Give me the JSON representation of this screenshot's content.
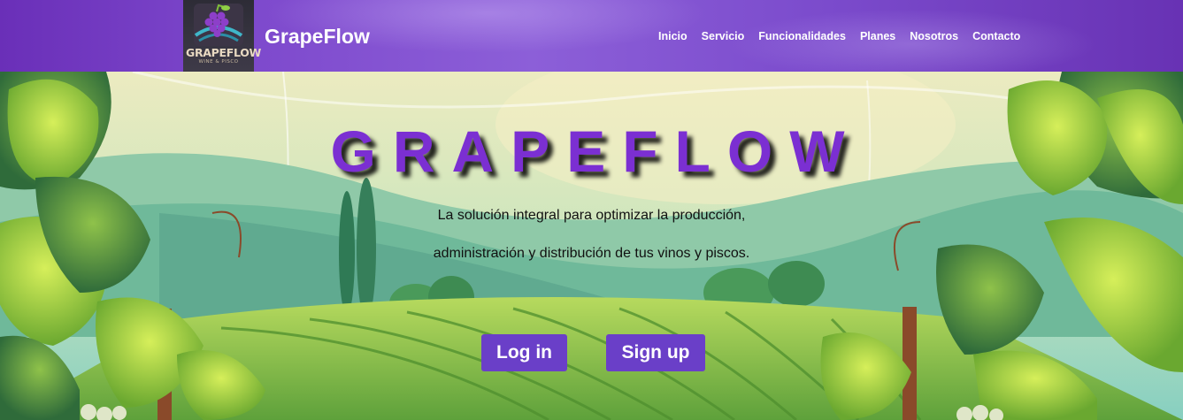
{
  "header": {
    "logo": {
      "word": "GRAPEFLOW",
      "sub": "WINE & PISCO"
    },
    "brand": "GrapeFlow",
    "nav": [
      {
        "label": "Inicio"
      },
      {
        "label": "Servicio"
      },
      {
        "label": "Funcionalidades"
      },
      {
        "label": "Planes"
      },
      {
        "label": "Nosotros"
      },
      {
        "label": "Contacto"
      }
    ]
  },
  "hero": {
    "title": "GRAPEFLOW",
    "line1": "La solución integral para optimizar la producción,",
    "line2": "administración y distribución de tus vinos y piscos.",
    "login_label": "Log in",
    "signup_label": "Sign up"
  },
  "colors": {
    "header_purple": "#7b48cc",
    "title_purple": "#7b2fd2",
    "button_purple": "#6a3fc8"
  }
}
